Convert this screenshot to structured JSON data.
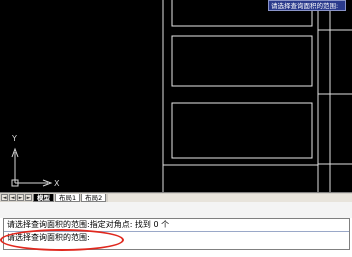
{
  "tooltip": {
    "text": "请选择查询面积的范围:"
  },
  "ucs": {
    "x_label": "X",
    "y_label": "Y"
  },
  "tabs": {
    "nav_buttons": [
      "◄",
      "◄",
      "►",
      "►"
    ],
    "items": [
      {
        "label": "模型",
        "active": true
      },
      {
        "label": "布局1",
        "active": false
      },
      {
        "label": "布局2",
        "active": false
      }
    ]
  },
  "command": {
    "history_line": "请选择查询面积的范围:指定对角点: 找到 0 个",
    "prompt_line": "请选择查询面积的范围:"
  },
  "colors": {
    "canvas_bg": "#000000",
    "geometry": "#ffffff",
    "highlight": "#e0281e"
  }
}
